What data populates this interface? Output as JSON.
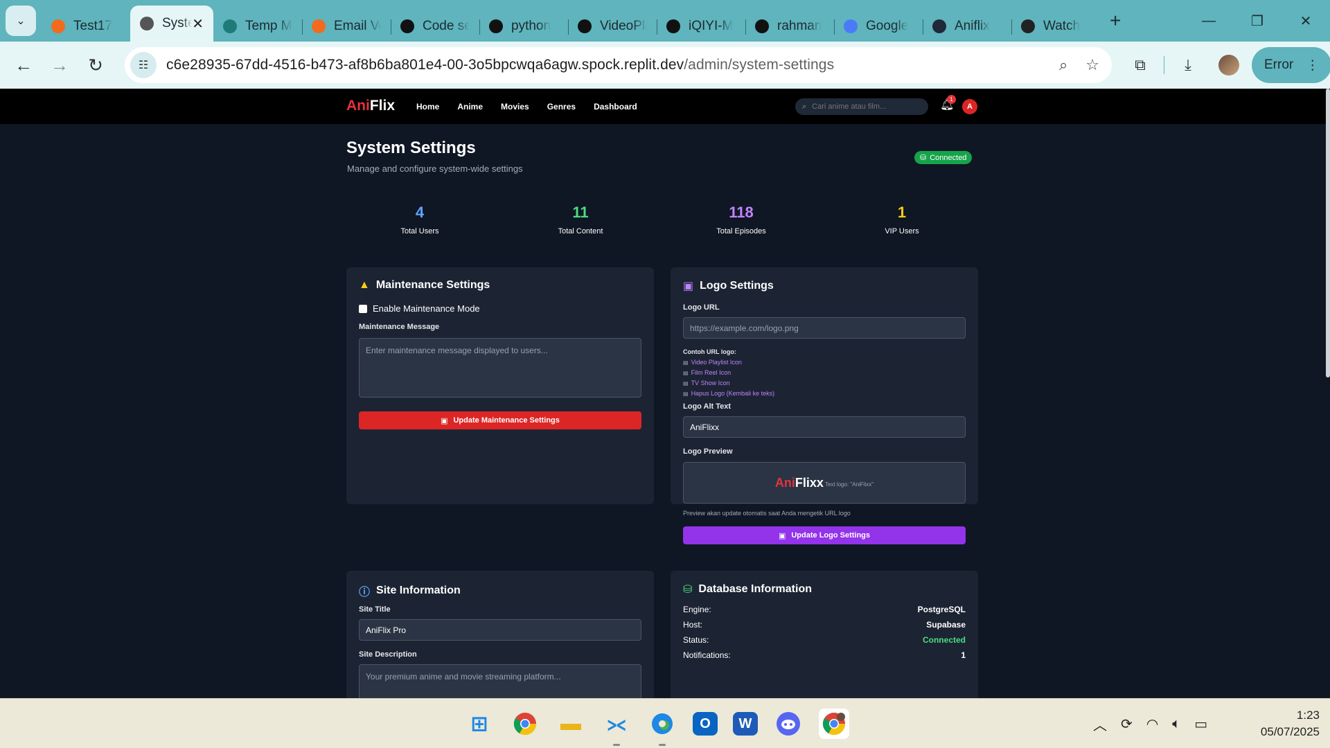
{
  "browser": {
    "tabs": [
      {
        "title": "Test17",
        "color": "#f26b1d"
      },
      {
        "title": "System Settings",
        "color": "#555555",
        "active": true
      },
      {
        "title": "Temp Mail",
        "color": "#1f7a7a"
      },
      {
        "title": "Email Verify",
        "color": "#f26b1d"
      },
      {
        "title": "Code search",
        "color": "#111111"
      },
      {
        "title": "python",
        "color": "#111111"
      },
      {
        "title": "VideoPlayer",
        "color": "#111111"
      },
      {
        "title": "iQIYI-M",
        "color": "#111111"
      },
      {
        "title": "rahman",
        "color": "#111111"
      },
      {
        "title": "Google",
        "color": "#4a7bf7"
      },
      {
        "title": "Aniflix",
        "color": "#1f2937"
      },
      {
        "title": "Watch",
        "color": "#222222"
      }
    ],
    "url_host": "c6e28935-67dd-4516-b473-af8b6ba801e4-00-3o5bpcwqa6agw.spock.replit.dev",
    "url_path": "/admin/system-settings",
    "error_label": "Error"
  },
  "app": {
    "brand_a": "Ani",
    "brand_b": "Flix",
    "nav": [
      "Home",
      "Anime",
      "Movies",
      "Genres",
      "Dashboard"
    ],
    "search_placeholder": "Cari anime atau film...",
    "notif_count": "1",
    "user_initial": "A"
  },
  "page": {
    "title": "System Settings",
    "subtitle": "Manage and configure system-wide settings",
    "status": "Connected"
  },
  "stats": [
    {
      "value": "4",
      "label": "Total Users",
      "color": "#60a5fa"
    },
    {
      "value": "11",
      "label": "Total Content",
      "color": "#4ade80"
    },
    {
      "value": "118",
      "label": "Total Episodes",
      "color": "#c084fc"
    },
    {
      "value": "1",
      "label": "VIP Users",
      "color": "#facc15"
    }
  ],
  "maintenance": {
    "title": "Maintenance Settings",
    "checkbox_label": "Enable Maintenance Mode",
    "message_label": "Maintenance Message",
    "message_placeholder": "Enter maintenance message displayed to users...",
    "button": "Update Maintenance Settings"
  },
  "logo": {
    "title": "Logo Settings",
    "url_label": "Logo URL",
    "url_placeholder": "https://example.com/logo.png",
    "examples_heading": "Contoh URL logo:",
    "examples": [
      "Video Playlist Icon",
      "Film Reel Icon",
      "TV Show Icon",
      "Hapus Logo (Kembali ke teks)"
    ],
    "alt_label": "Logo Alt Text",
    "alt_value": "AniFlixx",
    "preview_label": "Logo Preview",
    "preview_a": "Ani",
    "preview_b": "Flixx",
    "preview_caption": "Text logo: \"AniFlixx\"",
    "note": "Preview akan update otomatis saat Anda mengetik URL logo",
    "button": "Update Logo Settings"
  },
  "site": {
    "title": "Site Information",
    "site_title_label": "Site Title",
    "site_title_value": "AniFlix Pro",
    "desc_label": "Site Description",
    "desc_placeholder": "Your premium anime and movie streaming platform..."
  },
  "database": {
    "title": "Database Information",
    "rows": [
      {
        "k": "Engine:",
        "v": "PostgreSQL"
      },
      {
        "k": "Host:",
        "v": "Supabase"
      },
      {
        "k": "Status:",
        "v": "Connected"
      },
      {
        "k": "Notifications:",
        "v": "1"
      }
    ]
  },
  "taskbar": {
    "time": "1:23",
    "date": "05/07/2025"
  }
}
